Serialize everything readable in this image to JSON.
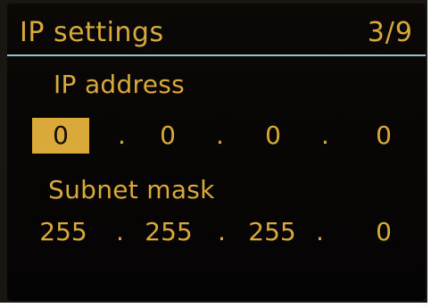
{
  "header": {
    "title": "IP settings",
    "page": "3/9"
  },
  "ip_address": {
    "label": "IP address",
    "octets": [
      "0",
      "0",
      "0",
      "0"
    ],
    "separator": ".",
    "selected_index": 0
  },
  "subnet_mask": {
    "label": "Subnet mask",
    "octets": [
      "255",
      "255",
      "255",
      "0"
    ],
    "separator": "."
  },
  "colors": {
    "text": "#d9a93a",
    "background": "#070504",
    "divider": "#8fc2c9",
    "selection": "#d9a93a"
  }
}
